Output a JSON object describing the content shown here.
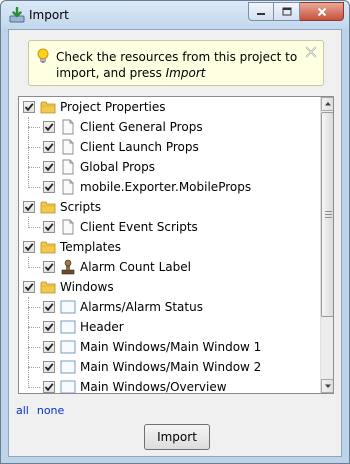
{
  "window": {
    "title": "Import",
    "buttons": [
      "minimize",
      "maximize",
      "close"
    ]
  },
  "tip": {
    "text_before": "Check the resources from this project to import, and press ",
    "text_emphasis": "Import",
    "icon": "lightbulb-icon"
  },
  "tree": {
    "nodes": [
      {
        "label": "Project Properties",
        "level": 0,
        "checked": true,
        "icon": "folder-icon"
      },
      {
        "label": "Client General Props",
        "level": 1,
        "checked": true,
        "icon": "page-icon"
      },
      {
        "label": "Client Launch Props",
        "level": 1,
        "checked": true,
        "icon": "page-icon"
      },
      {
        "label": "Global Props",
        "level": 1,
        "checked": true,
        "icon": "page-icon"
      },
      {
        "label": "mobile.Exporter.MobileProps",
        "level": 1,
        "checked": true,
        "icon": "page-icon"
      },
      {
        "label": "Scripts",
        "level": 0,
        "checked": true,
        "icon": "folder-icon"
      },
      {
        "label": "Client Event Scripts",
        "level": 1,
        "checked": true,
        "icon": "page-icon"
      },
      {
        "label": "Templates",
        "level": 0,
        "checked": true,
        "icon": "folder-icon"
      },
      {
        "label": "Alarm Count Label",
        "level": 1,
        "checked": true,
        "icon": "stamp-icon"
      },
      {
        "label": "Windows",
        "level": 0,
        "checked": true,
        "icon": "folder-icon"
      },
      {
        "label": "Alarms/Alarm Status",
        "level": 1,
        "checked": true,
        "icon": "window-icon"
      },
      {
        "label": "Header",
        "level": 1,
        "checked": true,
        "icon": "window-icon"
      },
      {
        "label": "Main Windows/Main Window 1",
        "level": 1,
        "checked": true,
        "icon": "window-icon"
      },
      {
        "label": "Main Windows/Main Window 2",
        "level": 1,
        "checked": true,
        "icon": "window-icon"
      },
      {
        "label": "Main Windows/Overview",
        "level": 1,
        "checked": true,
        "icon": "window-icon"
      }
    ]
  },
  "links": {
    "all": "all",
    "none": "none"
  },
  "actions": {
    "import_label": "Import"
  },
  "colors": {
    "link": "#0033cc",
    "tip_background": "#ffffe1",
    "folder": "#f2c94c"
  }
}
